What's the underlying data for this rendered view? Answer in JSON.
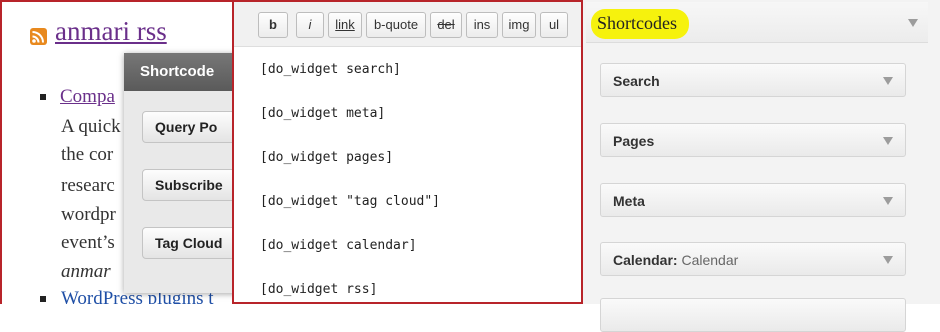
{
  "blog": {
    "title": "anmari rss",
    "link": "Compa",
    "paragraph_lines": [
      "A quick",
      "the cor",
      "researc",
      "wordpr",
      "event’s",
      "anmar"
    ],
    "link2": "WordPress plugins t"
  },
  "shortcode_popup": {
    "title": "Shortcode",
    "buttons": [
      "Query Po",
      "Subscribe",
      "Tag Cloud"
    ]
  },
  "editor": {
    "toolbar": [
      "b",
      "i",
      "link",
      "b-quote",
      "del",
      "ins",
      "img",
      "ul"
    ],
    "lines": [
      "[do_widget search]",
      "[do_widget meta]",
      "[do_widget pages]",
      "[do_widget \"tag cloud\"]",
      "[do_widget calendar]",
      "[do_widget rss]"
    ]
  },
  "widgets_panel": {
    "title": "Shortcodes",
    "highlight_color": "#f6f20d",
    "widgets": [
      {
        "label": "Search",
        "sub": ""
      },
      {
        "label": "Pages",
        "sub": ""
      },
      {
        "label": "Meta",
        "sub": ""
      },
      {
        "label": "Calendar:",
        "sub": "Calendar"
      }
    ]
  },
  "colors": {
    "accent_border": "#b8242a",
    "visited_link": "#6a2f8a",
    "link": "#1f4fa6",
    "rss_orange": "#e8891e"
  }
}
